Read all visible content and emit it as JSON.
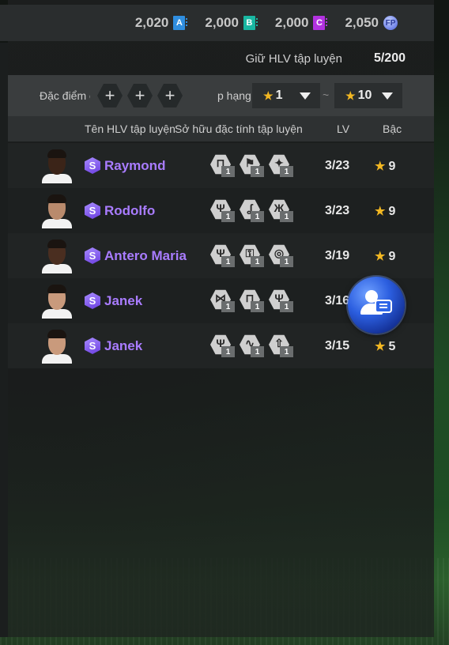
{
  "currencies": [
    {
      "value": "2,020",
      "badge": "A",
      "color": "#2f8ee0"
    },
    {
      "value": "2,000",
      "badge": "B",
      "color": "#19b7a2"
    },
    {
      "value": "2,000",
      "badge": "C",
      "color": "#b232e0"
    },
    {
      "value": "2,050",
      "badge": "FP",
      "color": "#6d80e8"
    }
  ],
  "hold": {
    "label": "Giữ HLV tập luyện",
    "value": "5/200"
  },
  "filter": {
    "trait_label": "Đặc điểm c",
    "rank_label": "p hạng",
    "rank_min": "1",
    "rank_sep": "~",
    "rank_max": "10"
  },
  "table": {
    "col_name": "Tên HLV tập luyện",
    "col_traits": "Sở hữu đặc tính tập luyện",
    "col_lv": "LV",
    "col_grade": "Bậc"
  },
  "coaches": [
    {
      "name": "Raymond",
      "lv": "3/23",
      "grade": "9",
      "skin": "#3b2418",
      "traits": [
        {
          "icon": "whistle-board",
          "glyph": "⊓",
          "level": "1"
        },
        {
          "icon": "player-dribble",
          "glyph": "⚑",
          "level": "1"
        },
        {
          "icon": "player-run",
          "glyph": "✦",
          "level": "1"
        }
      ]
    },
    {
      "name": "Rodolfo",
      "lv": "3/23",
      "grade": "9",
      "skin": "#b98a6c",
      "traits": [
        {
          "icon": "player-jump",
          "glyph": "Ψ",
          "level": "1"
        },
        {
          "icon": "ball-curve",
          "glyph": "ʆ",
          "level": "1"
        },
        {
          "icon": "player-tackle",
          "glyph": "Ж",
          "level": "1"
        }
      ]
    },
    {
      "name": "Antero Maria",
      "lv": "3/19",
      "grade": "9",
      "skin": "#4a2e20",
      "traits": [
        {
          "icon": "player-jump",
          "glyph": "Ψ",
          "level": "1"
        },
        {
          "icon": "lock-save",
          "glyph": "⚿",
          "level": "1"
        },
        {
          "icon": "ball-spin",
          "glyph": "◎",
          "level": "1"
        }
      ]
    },
    {
      "name": "Janek",
      "lv": "3/16",
      "grade": "",
      "skin": "#c99a7c",
      "traits": [
        {
          "icon": "pass-network",
          "glyph": "⋈",
          "level": "1"
        },
        {
          "icon": "whistle-board",
          "glyph": "⊓",
          "level": "1"
        },
        {
          "icon": "player-jump",
          "glyph": "Ψ",
          "level": "1"
        }
      ]
    },
    {
      "name": "Janek",
      "lv": "3/15",
      "grade": "5",
      "skin": "#c99a7c",
      "traits": [
        {
          "icon": "player-jump",
          "glyph": "Ψ",
          "level": "1"
        },
        {
          "icon": "ball-curve",
          "glyph": "∿",
          "level": "1"
        },
        {
          "icon": "up-arrow-power",
          "glyph": "⇧",
          "level": "1"
        }
      ]
    }
  ],
  "chat_button": {
    "icon": "friends-chat-icon"
  }
}
